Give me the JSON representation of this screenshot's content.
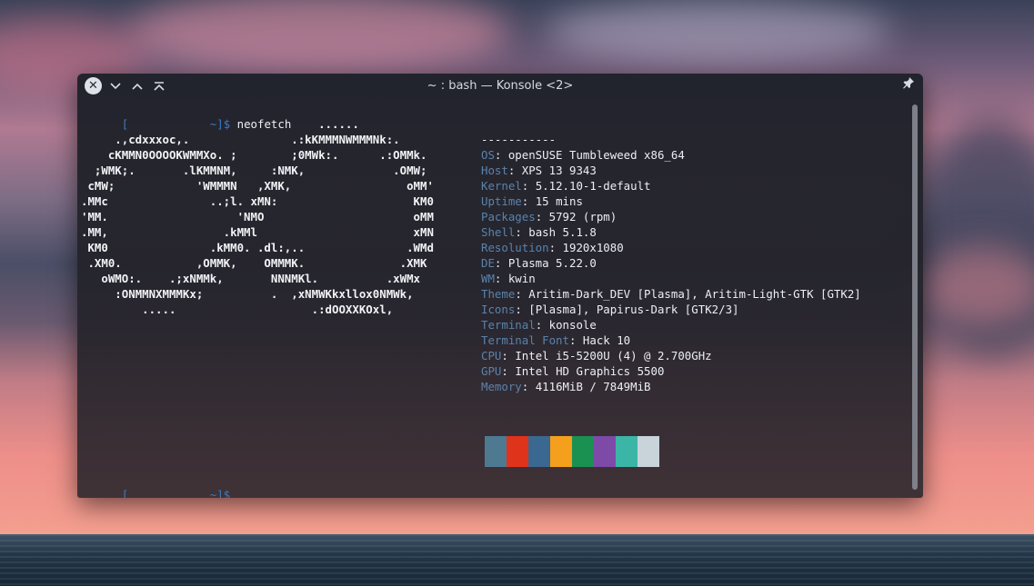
{
  "window": {
    "title": "~ : bash — Konsole <2>"
  },
  "prompt": {
    "open": "[",
    "dir": "~",
    "close": "]$",
    "command": "neofetch"
  },
  "ascii": [
    "                                   ......",
    "     .,cdxxxoc,.               .:kKMMMNWMMMNk:.",
    "    cKMMN0OOOOKWMMXo. ;        ;0MWk:.      .:OMMk.",
    "  ;WMK;.       .lKMMNM,     :NMK,             .OMW;",
    " cMW;            'WMMMN   ,XMK,                 oMM'",
    ".MMc               ..;l. xMN:                    KM0",
    "'MM.                   'NMO                      oMM",
    ".MM,                 .kMMl                       xMN",
    " KM0               .kMM0. .dl:,..               .WMd",
    " .XM0.           ,OMMK,    OMMMK.              .XMK",
    "   oWMO:.    .;xNMMk,       NNNMKl.          .xWMx",
    "     :ONMMNXMMMKx;          .  ,xNMWKkxllox0NMWk,",
    "         .....                    .:dOOXXKOxl,"
  ],
  "info": {
    "separator": "-----------",
    "rows": [
      {
        "key": "OS",
        "value": "openSUSE Tumbleweed x86_64"
      },
      {
        "key": "Host",
        "value": "XPS 13 9343"
      },
      {
        "key": "Kernel",
        "value": "5.12.10-1-default"
      },
      {
        "key": "Uptime",
        "value": "15 mins"
      },
      {
        "key": "Packages",
        "value": "5792 (rpm)"
      },
      {
        "key": "Shell",
        "value": "bash 5.1.8"
      },
      {
        "key": "Resolution",
        "value": "1920x1080"
      },
      {
        "key": "DE",
        "value": "Plasma 5.22.0"
      },
      {
        "key": "WM",
        "value": "kwin"
      },
      {
        "key": "Theme",
        "value": "Aritim-Dark_DEV [Plasma], Aritim-Light-GTK [GTK2]"
      },
      {
        "key": "Icons",
        "value": "[Plasma], Papirus-Dark [GTK2/3]"
      },
      {
        "key": "Terminal",
        "value": "konsole"
      },
      {
        "key": "Terminal Font",
        "value": "Hack 10"
      },
      {
        "key": "CPU",
        "value": "Intel i5-5200U (4) @ 2.700GHz"
      },
      {
        "key": "GPU",
        "value": "Intel HD Graphics 5500"
      },
      {
        "key": "Memory",
        "value": "4116MiB / 7849MiB"
      }
    ]
  },
  "palette": [
    "#4e7a91",
    "#e0331c",
    "#3b6890",
    "#f5a01d",
    "#1a9150",
    "#7d4aa8",
    "#3bb5a6",
    "#c9d3da"
  ],
  "colors": {
    "prompt_blue": "#3f7bc0",
    "key_blue": "#5a83ab"
  }
}
